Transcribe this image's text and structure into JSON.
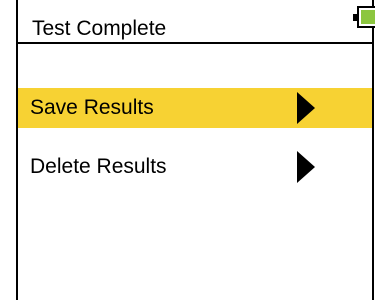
{
  "header": {
    "title": "Test Complete",
    "battery": {
      "icon": "battery-full-icon",
      "level": 1.0,
      "fill_color": "#8cc63f"
    }
  },
  "menu": {
    "selected_color": "#f7d233",
    "items": [
      {
        "label": "Save Results",
        "icon": "chevron-right-icon",
        "selected": true
      },
      {
        "label": "Delete Results",
        "icon": "chevron-right-icon",
        "selected": false
      }
    ]
  }
}
